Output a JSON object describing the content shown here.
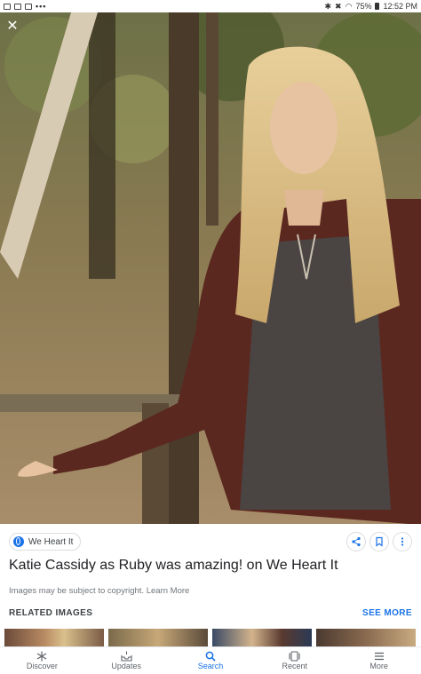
{
  "status_bar": {
    "left_dots": "•••",
    "battery": "75%",
    "time": "12:52 PM"
  },
  "close_icon": "✕",
  "source": {
    "name": "We Heart It"
  },
  "title": "Katie Cassidy as Ruby was amazing! on We Heart It",
  "copyright": "Images may be subject to copyright. Learn More",
  "related": {
    "label": "RELATED IMAGES",
    "see_more": "SEE MORE"
  },
  "bottom_nav": {
    "discover": "Discover",
    "updates": "Updates",
    "search": "Search",
    "recent": "Recent",
    "more": "More",
    "active": "search"
  },
  "colors": {
    "accent": "#1a73e8",
    "icon_gray": "#5f6368"
  }
}
